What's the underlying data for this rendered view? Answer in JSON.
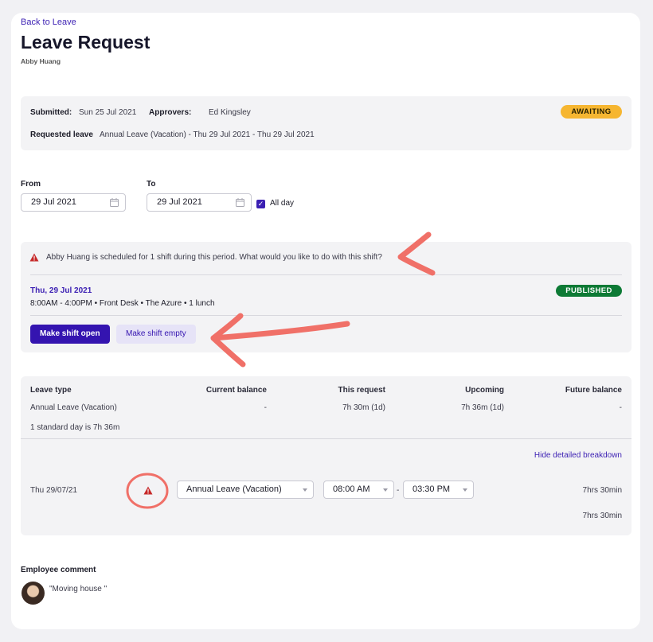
{
  "header": {
    "back_link": "Back to Leave",
    "title": "Leave Request",
    "employee": "Abby Huang"
  },
  "summary": {
    "submitted_label": "Submitted:",
    "submitted_value": "Sun 25 Jul 2021",
    "approvers_label": "Approvers:",
    "approvers_value": "Ed Kingsley",
    "status": "AWAITING",
    "requested_label": "Requested leave",
    "requested_value": "Annual Leave (Vacation) - Thu 29 Jul 2021 - Thu 29 Jul 2021"
  },
  "dates": {
    "from_label": "From",
    "from_value": "29 Jul 2021",
    "to_label": "To",
    "to_value": "29 Jul 2021",
    "all_day_label": "All day",
    "all_day_checked": true
  },
  "shift_warning": {
    "message": "Abby Huang is scheduled for 1 shift during this period. What would you like to do with this shift?",
    "shift_date": "Thu, 29 Jul 2021",
    "shift_detail": "8:00AM - 4:00PM • Front Desk • The Azure • 1 lunch",
    "status": "PUBLISHED",
    "open_button": "Make shift open",
    "empty_button": "Make shift empty"
  },
  "balance": {
    "headers": [
      "Leave type",
      "Current balance",
      "This request",
      "Upcoming",
      "Future balance"
    ],
    "row": [
      "Annual Leave (Vacation)",
      "-",
      "7h 30m (1d)",
      "7h 36m (1d)",
      "-"
    ],
    "note": "1 standard day is 7h 36m",
    "toggle_link": "Hide detailed breakdown",
    "breakdown": {
      "date": "Thu 29/07/21",
      "leave_type": "Annual Leave (Vacation)",
      "start_time": "08:00 AM",
      "end_time": "03:30 PM",
      "separator": "-",
      "hours": "7hrs 30min",
      "total": "7hrs 30min"
    }
  },
  "comment": {
    "label": "Employee comment",
    "text": "\"Moving house \""
  },
  "colors": {
    "accent": "#3414b0",
    "awaiting": "#f6b631",
    "published": "#0d7a35",
    "warning": "#c62828",
    "annotation": "#f07068"
  }
}
